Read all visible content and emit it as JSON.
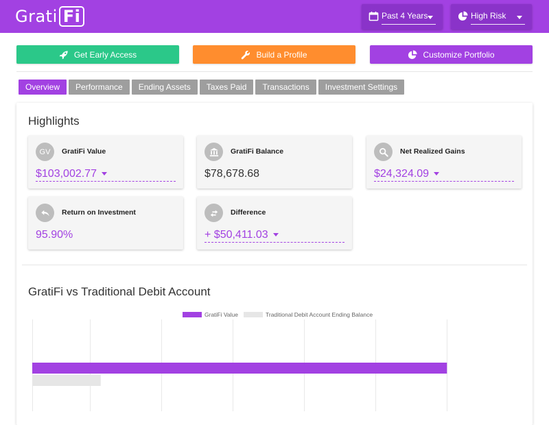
{
  "header": {
    "logo": {
      "text_plain": "Grati",
      "text_boxed": "Fi"
    },
    "period_select": {
      "icon": "calendar-icon",
      "value": "Past 4 Years"
    },
    "risk_select": {
      "icon": "pie-chart-icon",
      "value": "High Risk"
    }
  },
  "actions": [
    {
      "label": "Get Early Access",
      "icon": "rocket-icon",
      "color": "#2bc889"
    },
    {
      "label": "Build a Profile",
      "icon": "wrench-icon",
      "color": "#ff8d2e"
    },
    {
      "label": "Customize Portfolio",
      "icon": "pie-chart-icon",
      "color": "#a241e2"
    }
  ],
  "tabs": [
    {
      "label": "Overview",
      "active": true
    },
    {
      "label": "Performance",
      "active": false
    },
    {
      "label": "Ending Assets",
      "active": false
    },
    {
      "label": "Taxes Paid",
      "active": false
    },
    {
      "label": "Transactions",
      "active": false
    },
    {
      "label": "Investment Settings",
      "active": false
    }
  ],
  "highlights": {
    "title": "Highlights",
    "cards": [
      {
        "icon_text": "GV",
        "label": "GratiFi Value",
        "value": "$103,002.77"
      },
      {
        "icon": "bank-icon",
        "label": "GratiFi Balance",
        "value": "$78,678.68"
      },
      {
        "icon": "search-icon",
        "label": "Net Realized Gains",
        "value": "$24,324.09"
      },
      {
        "icon": "undo-icon",
        "label": "Return on Investment",
        "value": "95.90%"
      },
      {
        "icon": "swap-icon",
        "label": "Difference",
        "value": "+ $50,411.03"
      }
    ]
  },
  "comparison": {
    "title": "GratiFi vs Traditional Debit Account"
  },
  "colors": {
    "accent": "#a241e2",
    "header_select": "#8a33c9",
    "tab_inactive": "#9e9e9e"
  },
  "chart_data": {
    "type": "bar",
    "orientation": "horizontal",
    "legend_position": "top-center",
    "grid": true,
    "series": [
      {
        "name": "GratiFi Value",
        "color": "#a241e2",
        "values": [
          103002.77
        ]
      },
      {
        "name": "Traditional Debit Account Ending Balance",
        "color": "#e6e6e6",
        "values": [
          17000
        ]
      }
    ],
    "xlim": [
      0,
      120000
    ]
  }
}
